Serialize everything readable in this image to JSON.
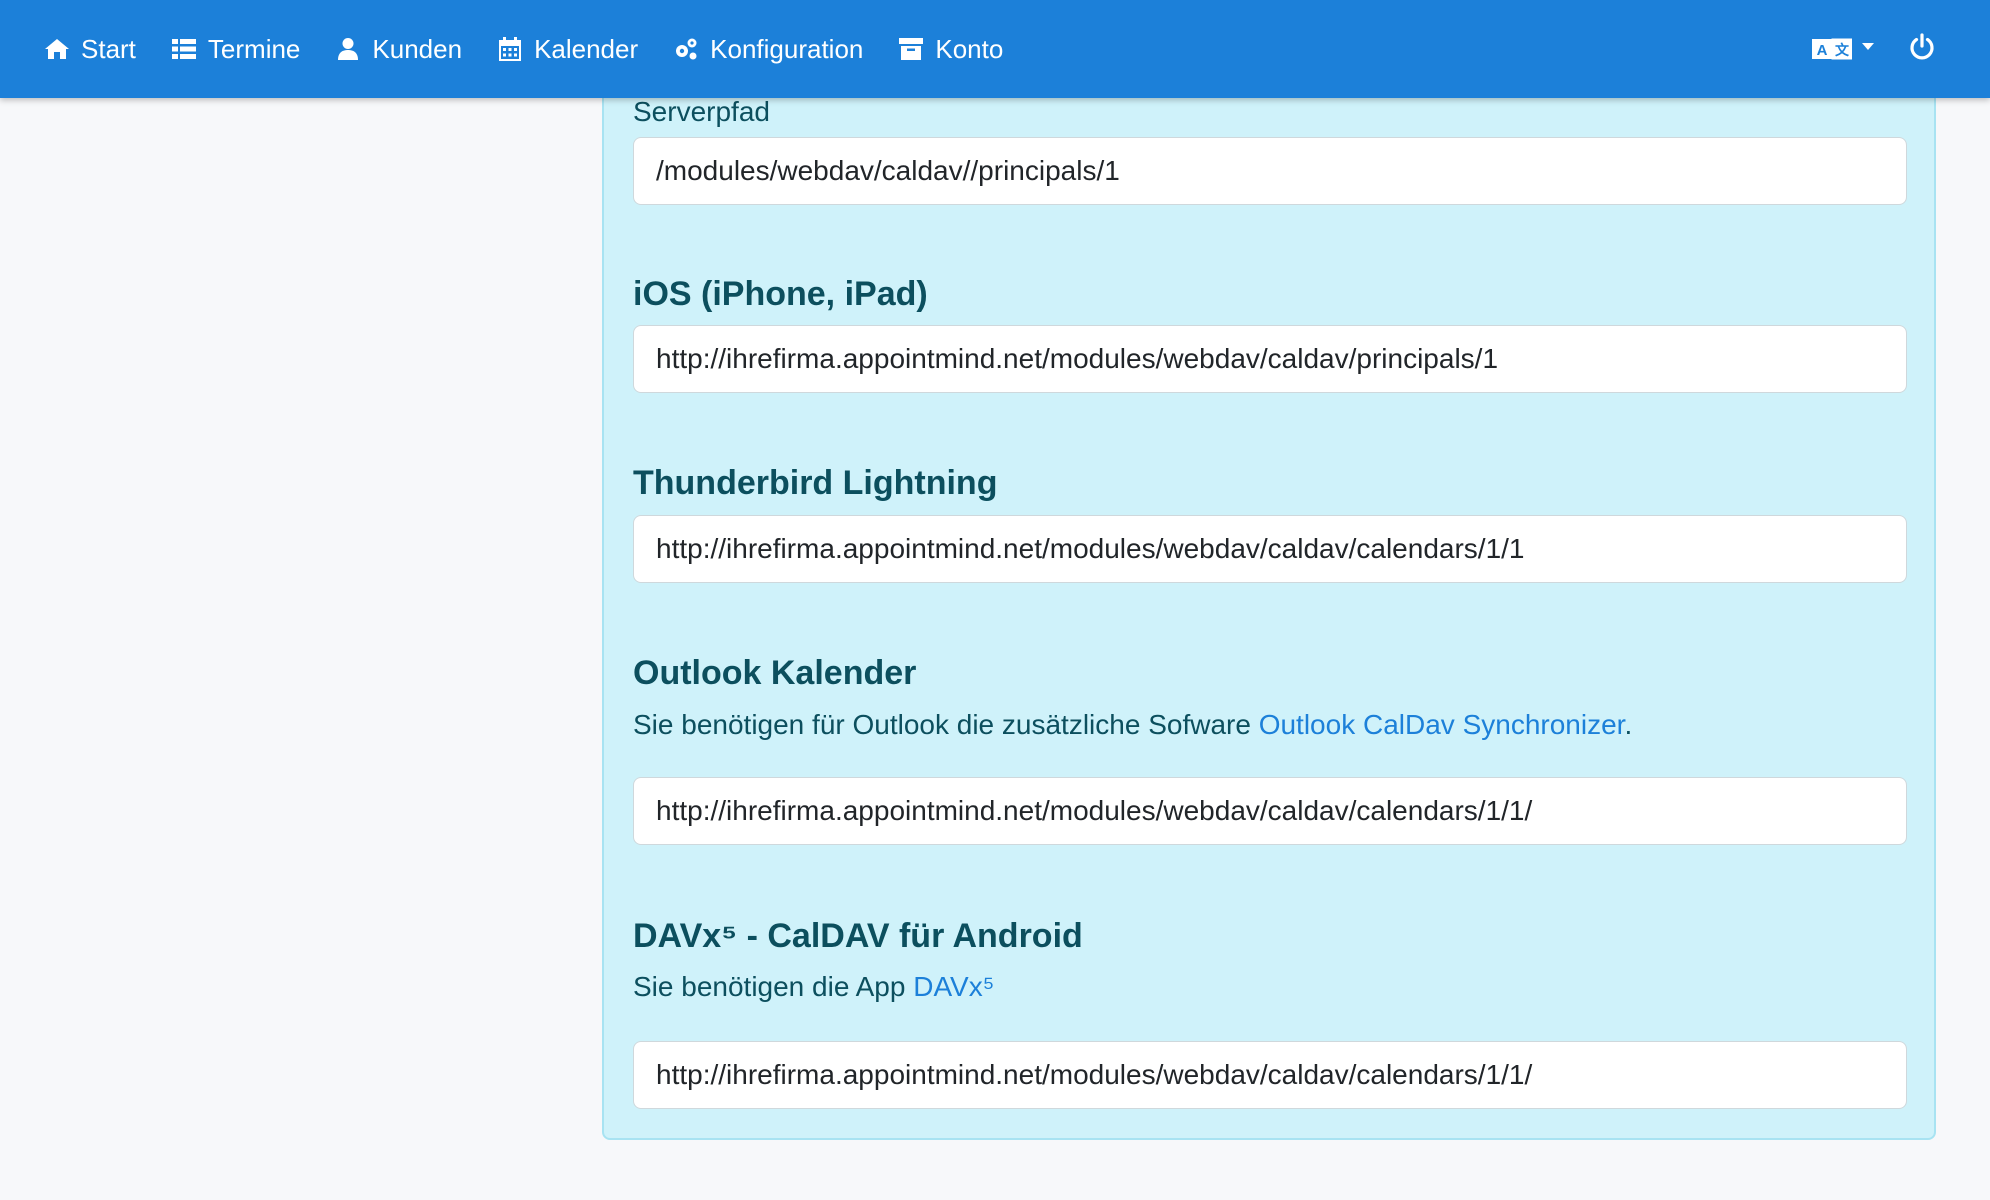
{
  "nav": {
    "items": [
      {
        "label": "Start",
        "icon": "home-icon"
      },
      {
        "label": "Termine",
        "icon": "list-icon"
      },
      {
        "label": "Kunden",
        "icon": "user-icon"
      },
      {
        "label": "Kalender",
        "icon": "calendar-icon"
      },
      {
        "label": "Konfiguration",
        "icon": "gears-icon"
      },
      {
        "label": "Konto",
        "icon": "archive-icon"
      }
    ],
    "right": {
      "language_icon": "translate-icon",
      "power_icon": "power-icon"
    }
  },
  "colors": {
    "navbar": "#1c80d9",
    "panel": "#cff2fa",
    "heading": "#0c4f5e",
    "link": "#1c80d9"
  },
  "sections": {
    "serverpfad": {
      "label": "Serverpfad",
      "value": "/modules/webdav/caldav//principals/1"
    },
    "ios": {
      "title": "iOS (iPhone, iPad)",
      "value": "http://ihrefirma.appointmind.net/modules/webdav/caldav/principals/1"
    },
    "thunderbird": {
      "title": "Thunderbird Lightning",
      "value": "http://ihrefirma.appointmind.net/modules/webdav/caldav/calendars/1/1"
    },
    "outlook": {
      "title": "Outlook Kalender",
      "desc_prefix": "Sie benötigen für Outlook die zusätzliche Sofware ",
      "desc_link": "Outlook CalDav Synchronizer",
      "desc_suffix": ".",
      "value": "http://ihrefirma.appointmind.net/modules/webdav/caldav/calendars/1/1/"
    },
    "davx": {
      "title": "DAVx⁵ - CalDAV für Android",
      "desc_prefix": "Sie benötigen die App ",
      "desc_link": "DAVx⁵",
      "value": "http://ihrefirma.appointmind.net/modules/webdav/caldav/calendars/1/1/"
    }
  }
}
